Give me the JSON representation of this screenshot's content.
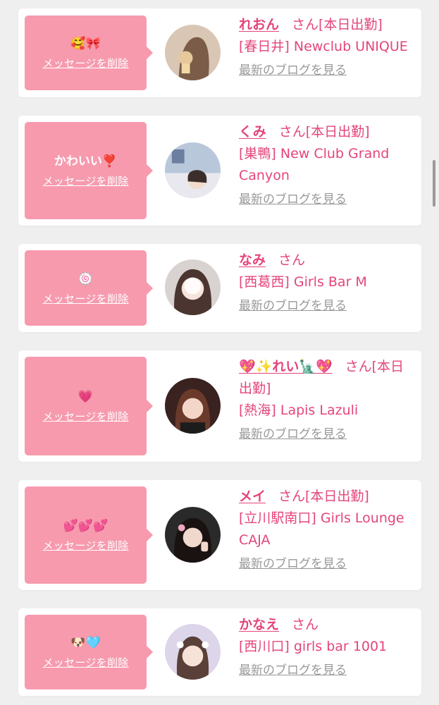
{
  "colors": {
    "accent": "#e4457a",
    "bubble": "#f79aae",
    "link_gray": "#999999",
    "background": "#efefef"
  },
  "cards": [
    {
      "message": "🥰🎀",
      "delete_label": "メッセージを削除",
      "name": "れおん",
      "suffix": "さん[本日出勤]",
      "venue": "[春日井] Newclub UNIQUE",
      "blog_link": "最新のブログを見る"
    },
    {
      "message": "かわいい❣️",
      "delete_label": "メッセージを削除",
      "name": "くみ",
      "suffix": "さん[本日出勤]",
      "venue": "[巣鴨] New Club Grand Canyon",
      "blog_link": "最新のブログを見る"
    },
    {
      "message": "🍥",
      "delete_label": "メッセージを削除",
      "name": "なみ",
      "suffix": "さん",
      "venue": "[西葛西] Girls Bar M",
      "blog_link": "最新のブログを見る"
    },
    {
      "message": "💗",
      "delete_label": "メッセージを削除",
      "name": "💖✨れい🗽💖",
      "suffix": "さん[本日出勤]",
      "venue": "[熱海] Lapis Lazuli",
      "blog_link": "最新のブログを見る"
    },
    {
      "message": "💕💕💕",
      "delete_label": "メッセージを削除",
      "name": "メイ",
      "suffix": "さん[本日出勤]",
      "venue": "[立川駅南口] Girls Lounge CAJA",
      "blog_link": "最新のブログを見る"
    },
    {
      "message": "🐶🩵",
      "delete_label": "メッセージを削除",
      "name": "かなえ",
      "suffix": "さん",
      "venue": "[西川口] girls bar 1001",
      "blog_link": "最新のブログを見る"
    }
  ]
}
